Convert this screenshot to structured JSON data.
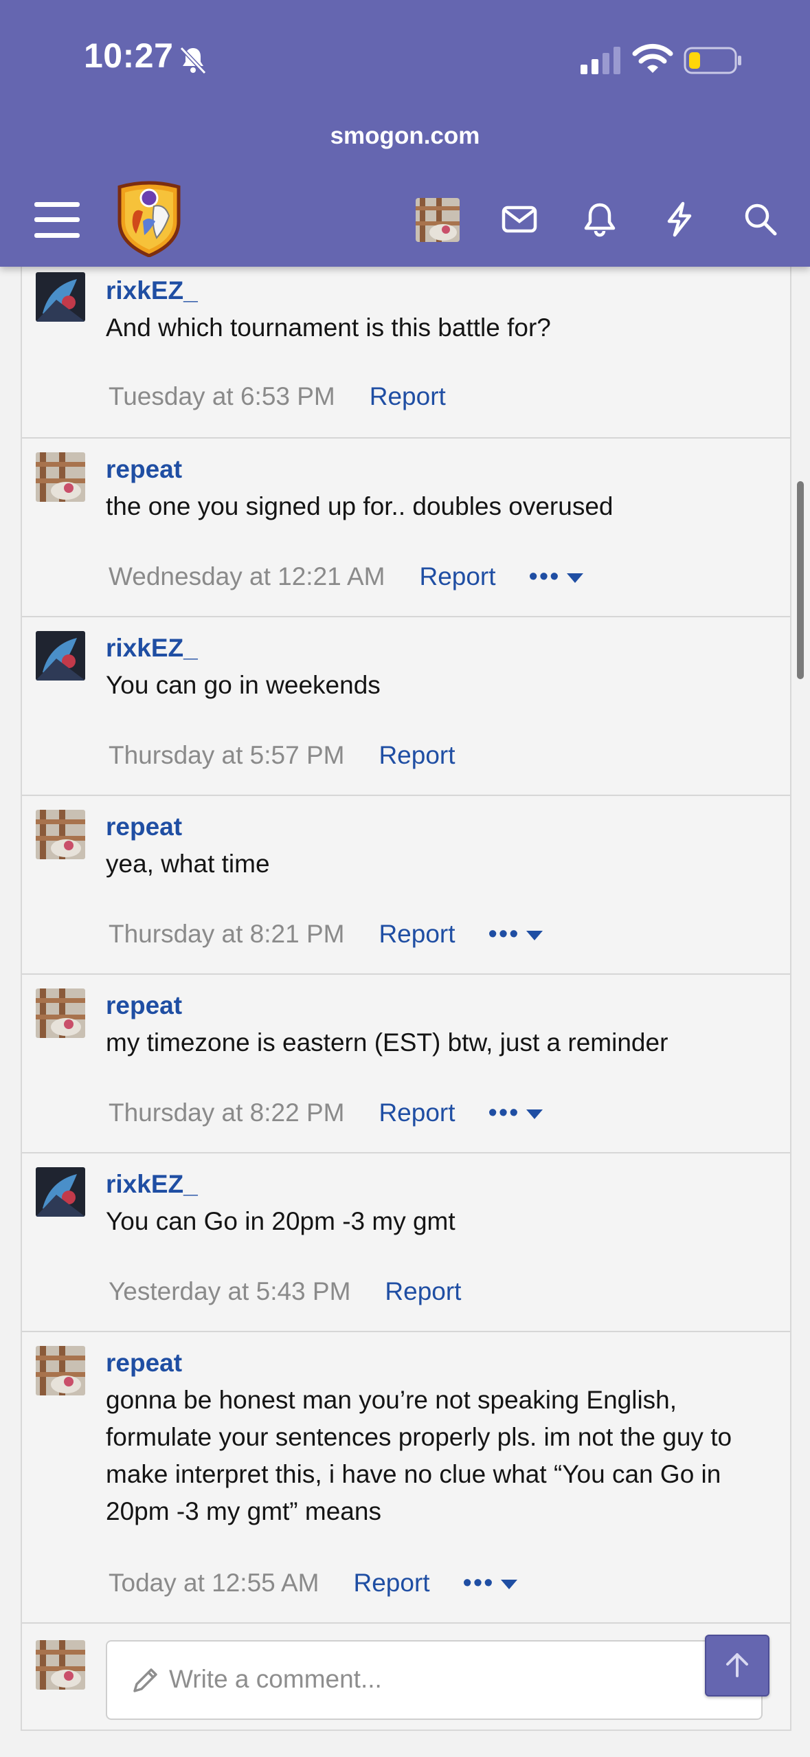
{
  "status": {
    "time": "10:27"
  },
  "browser": {
    "domain": "smogon.com"
  },
  "comments": [
    {
      "user": "rixkEZ_",
      "message": "And which tournament is this battle for?",
      "time": "Tuesday at 6:53 PM",
      "report": "Report"
    },
    {
      "user": "repeat",
      "message": "the one you signed up for.. doubles overused",
      "time": "Wednesday at 12:21 AM",
      "report": "Report",
      "more": "•••"
    },
    {
      "user": "rixkEZ_",
      "message": "You can go in weekends",
      "time": "Thursday at 5:57 PM",
      "report": "Report"
    },
    {
      "user": "repeat",
      "message": "yea, what time",
      "time": "Thursday at 8:21 PM",
      "report": "Report",
      "more": "•••"
    },
    {
      "user": "repeat",
      "message": "my timezone is eastern (EST) btw, just a reminder",
      "time": "Thursday at 8:22 PM",
      "report": "Report",
      "more": "•••"
    },
    {
      "user": "rixkEZ_",
      "message": "You can Go in 20pm -3 my gmt",
      "time": "Yesterday at 5:43 PM",
      "report": "Report"
    },
    {
      "user": "repeat",
      "message": "gonna be honest man you’re not speaking English, formulate your sentences properly pls. im not the guy to make interpret this, i have no clue what “You can Go in 20pm -3 my gmt” means",
      "time": "Today at 12:55 AM",
      "report": "Report",
      "more": "•••"
    }
  ],
  "composer": {
    "placeholder": "Write a comment..."
  },
  "colors": {
    "header": "#6566b0",
    "link": "#1f4ea3"
  }
}
